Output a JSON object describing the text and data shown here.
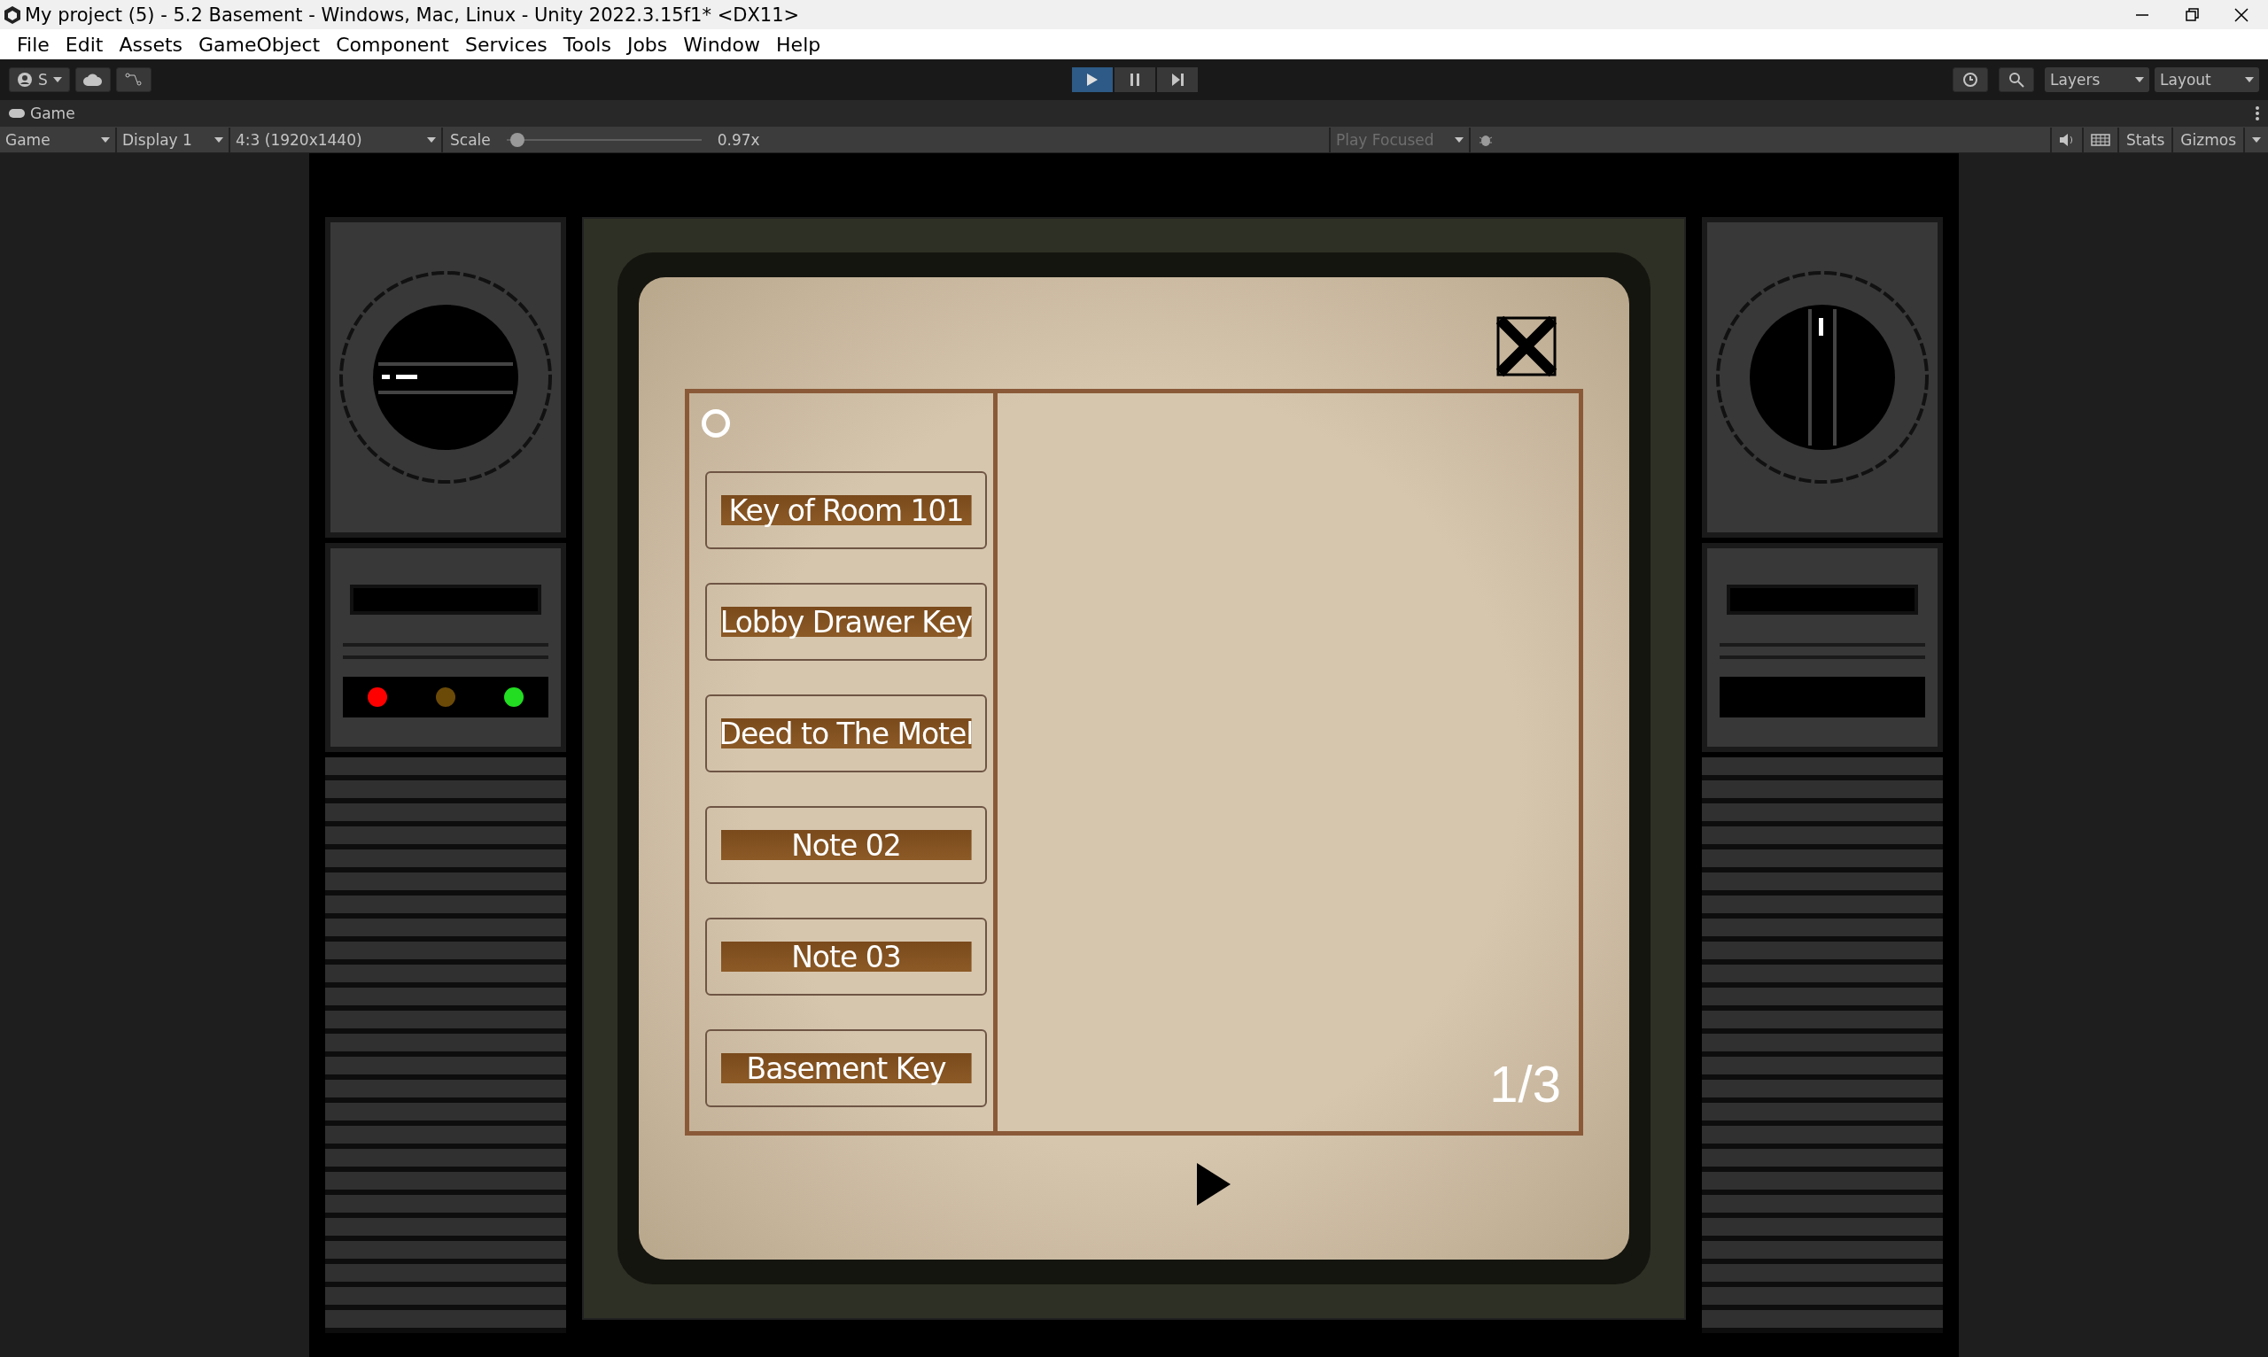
{
  "window": {
    "title": "My project (5) - 5.2 Basement - Windows, Mac, Linux - Unity 2022.3.15f1* <DX11>"
  },
  "menu": [
    "File",
    "Edit",
    "Assets",
    "GameObject",
    "Component",
    "Services",
    "Tools",
    "Jobs",
    "Window",
    "Help"
  ],
  "toolbar": {
    "account": "S",
    "play_controls": [
      {
        "kind": "play",
        "selected": true
      },
      {
        "kind": "pause",
        "selected": false
      },
      {
        "kind": "step",
        "selected": false
      }
    ],
    "layers": "Layers",
    "layout": "Layout"
  },
  "game_tab": {
    "title": "Game"
  },
  "game_bar": {
    "view": "Game",
    "display": "Display 1",
    "aspect": "4:3 (1920x1440)",
    "scale_label": "Scale",
    "scale": {
      "level": 0.02
    },
    "scale_reading": "0.97x",
    "play_mode": "Play Focused",
    "stats": "Stats",
    "gizmos": "Gizmos"
  },
  "game": {
    "lights": [
      {
        "color": "#ff0000"
      },
      {
        "color": "#6b4a08"
      },
      {
        "color": "#22dd22"
      }
    ],
    "items": [
      "Key of Room 101",
      "Lobby Drawer Key",
      "Deed to The Motel",
      "Note 02",
      "Note 03",
      "Basement Key"
    ],
    "page": "1/3"
  }
}
